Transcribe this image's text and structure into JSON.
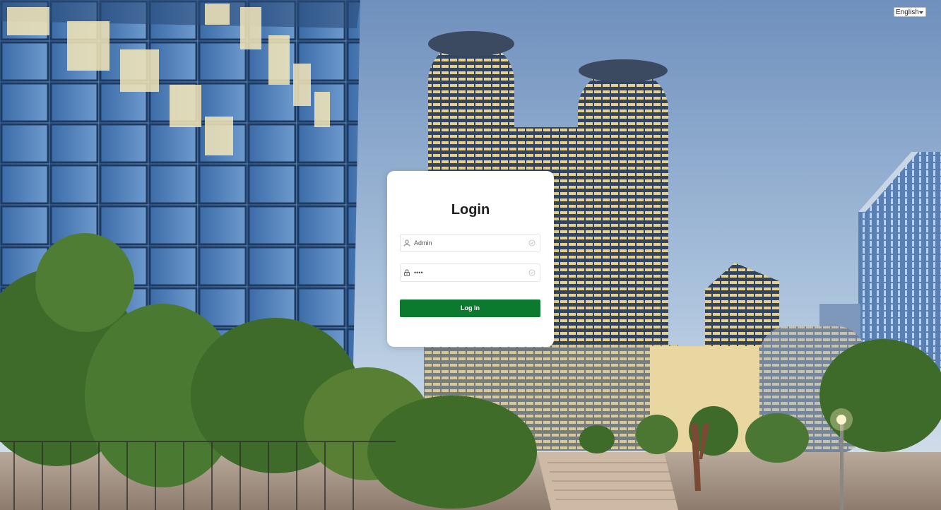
{
  "language": {
    "selected": "English",
    "icon": "chevron-down-icon"
  },
  "login": {
    "title": "Login",
    "username": {
      "value": "Admin",
      "icon": "user-icon",
      "clear_icon": "clear-icon"
    },
    "password": {
      "value": "••••",
      "icon": "lock-icon",
      "clear_icon": "clear-icon"
    },
    "submit_label": "Log In"
  },
  "colors": {
    "button": "#0c7a2e",
    "card": "#ffffff",
    "sky": "#bcd1e6"
  }
}
